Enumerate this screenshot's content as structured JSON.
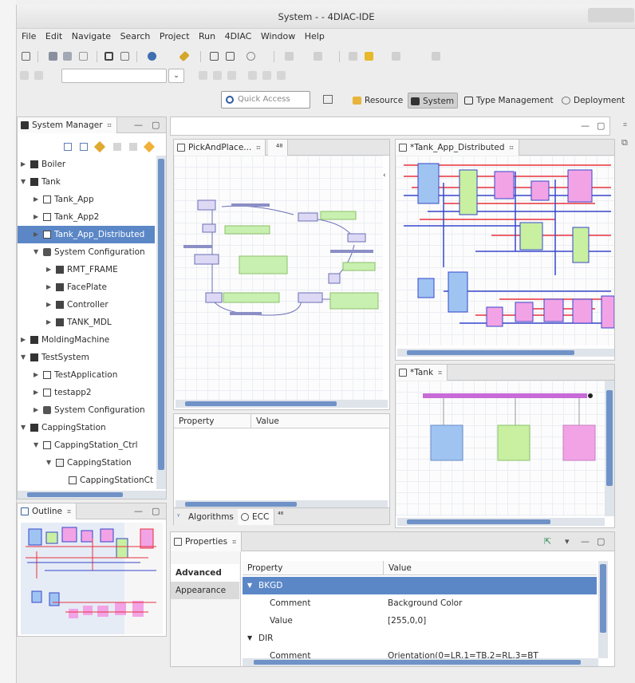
{
  "window": {
    "title": "System - - 4DIAC-IDE"
  },
  "menu": [
    "File",
    "Edit",
    "Navigate",
    "Search",
    "Project",
    "Run",
    "4DIAC",
    "Window",
    "Help"
  ],
  "quick_access": {
    "placeholder": "Quick Access"
  },
  "perspectives": [
    {
      "label": "Resource",
      "active": false
    },
    {
      "label": "System",
      "active": true
    },
    {
      "label": "Type Management",
      "active": false
    },
    {
      "label": "Deployment",
      "active": false
    }
  ],
  "system_manager": {
    "title": "System Manager",
    "tree": [
      {
        "label": "Boiler",
        "level": 0,
        "expanded": false,
        "icon": "system-icon"
      },
      {
        "label": "Tank",
        "level": 0,
        "expanded": true,
        "icon": "system-icon"
      },
      {
        "label": "Tank_App",
        "level": 1,
        "expanded": false,
        "icon": "application-icon"
      },
      {
        "label": "Tank_App2",
        "level": 1,
        "expanded": false,
        "icon": "application-icon"
      },
      {
        "label": "Tank_App_Distributed",
        "level": 1,
        "expanded": false,
        "icon": "application-icon",
        "selected": true
      },
      {
        "label": "System Configuration",
        "level": 1,
        "expanded": true,
        "icon": "configuration-icon"
      },
      {
        "label": "RMT_FRAME",
        "level": 2,
        "expanded": false,
        "icon": "device-icon"
      },
      {
        "label": "FacePlate",
        "level": 2,
        "expanded": false,
        "icon": "device-icon"
      },
      {
        "label": "Controller",
        "level": 2,
        "expanded": false,
        "icon": "device-icon"
      },
      {
        "label": "TANK_MDL",
        "level": 2,
        "expanded": false,
        "icon": "device-icon"
      },
      {
        "label": "MoldingMachine",
        "level": 0,
        "expanded": false,
        "icon": "system-icon"
      },
      {
        "label": "TestSystem",
        "level": 0,
        "expanded": true,
        "icon": "system-icon"
      },
      {
        "label": "TestApplication",
        "level": 1,
        "expanded": false,
        "icon": "application-icon"
      },
      {
        "label": "testapp2",
        "level": 1,
        "expanded": false,
        "icon": "application-icon"
      },
      {
        "label": "System Configuration",
        "level": 1,
        "expanded": false,
        "icon": "configuration-icon"
      },
      {
        "label": "CappingStation",
        "level": 0,
        "expanded": true,
        "icon": "system-icon"
      },
      {
        "label": "CappingStation_Ctrl",
        "level": 1,
        "expanded": true,
        "icon": "application-icon"
      },
      {
        "label": "CappingStation",
        "level": 2,
        "expanded": true,
        "icon": "subapp-icon"
      },
      {
        "label": "CappingStationCt",
        "level": 3,
        "expanded": null,
        "icon": "fb-icon"
      }
    ]
  },
  "outline": {
    "title": "Outline"
  },
  "editors": {
    "pick_and_place": {
      "tab": "PickAndPlace...",
      "bottom_tabs": [
        "Algorithms",
        "ECC"
      ]
    },
    "tank_app_distributed": {
      "tab": "*Tank_App_Distributed"
    },
    "tank": {
      "tab": "*Tank"
    }
  },
  "small_props": {
    "headers": [
      "Property",
      "Value"
    ]
  },
  "properties": {
    "title": "Properties",
    "side_tabs": [
      "Advanced",
      "Appearance"
    ],
    "headers": [
      "Property",
      "Value"
    ],
    "rows": [
      {
        "group": "BKGD",
        "selected": true
      },
      {
        "property": "Comment",
        "value": "Background Color"
      },
      {
        "property": "Value",
        "value": "[255,0,0]"
      },
      {
        "group": "DIR"
      },
      {
        "property": "Comment",
        "value": "Orientation(0=LR,1=TB,2=RL,3=BT"
      }
    ]
  },
  "colors": {
    "selection": "#5b87c7",
    "fb_blue": "#9fc4f2",
    "fb_green": "#c8f0a0",
    "fb_pink": "#f2a3e6",
    "connection_red": "#e8323c",
    "connection_blue": "#3646c9"
  }
}
